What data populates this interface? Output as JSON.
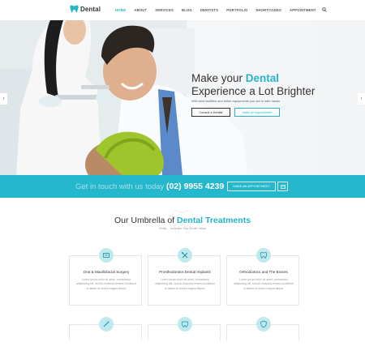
{
  "brand": {
    "name": "Dental"
  },
  "nav": {
    "items": [
      {
        "label": "HOME"
      },
      {
        "label": "ABOUT"
      },
      {
        "label": "SERVICES"
      },
      {
        "label": "BLOG"
      },
      {
        "label": "DENTISTS"
      },
      {
        "label": "PORTFOLIO"
      },
      {
        "label": "SHORTCODES"
      },
      {
        "label": "APPOINTMENT"
      }
    ],
    "search_icon": "search-icon"
  },
  "hero": {
    "title_prefix": "Make your ",
    "title_accent": "Dental",
    "title_line2": "Experience a Lot Brighter",
    "subtitle": "With best facilities and better equipments you are in safe hands",
    "consult_label": "Consult a Dentist",
    "appointment_label": "Make an Appointment"
  },
  "cta_band": {
    "text": "Get in touch with us today",
    "phone": "(02) 9955 4239",
    "button_label": "MAKE AN APPOINTMENT",
    "icon": "calendar-icon"
  },
  "treatments": {
    "title_prefix": "Our Umbrella of ",
    "title_accent": "Dental Treatments",
    "subtitle": "Smile... Increase Your Smile Value",
    "cards": [
      {
        "title": "Oral & Maxillofacial Surgery",
        "text": "Lorem ipsum dolor sit amet, consectetur adipisicing elit, sed do eiusmod tempor incididunt ut labore et dolore magna aliqua."
      },
      {
        "title": "Prosthodontics Dental Implants",
        "text": "Lorem ipsum dolor sit amet, consectetur adipisicing elit, sed do eiusmod tempor incididunt ut labore et dolore magna aliqua."
      },
      {
        "title": "Orthodontics and The Braces",
        "text": "Lorem ipsum dolor sit amet, consectetur adipisicing elit, sed do eiusmod tempor incididunt ut labore et dolore magna aliqua."
      }
    ]
  },
  "colors": {
    "accent": "#24b6c8",
    "band": "#25b7cb"
  }
}
